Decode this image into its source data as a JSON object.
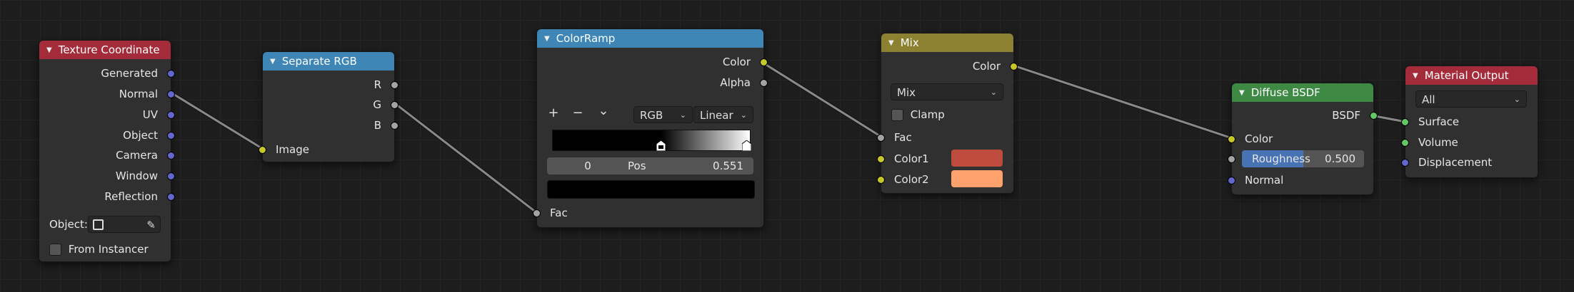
{
  "nodes": {
    "texture_coordinate": {
      "title": "Texture Coordinate",
      "outputs": [
        "Generated",
        "Normal",
        "UV",
        "Object",
        "Camera",
        "Window",
        "Reflection"
      ],
      "object_label": "Object:",
      "from_instancer": "From Instancer"
    },
    "separate_rgb": {
      "title": "Separate RGB",
      "outputs": [
        "R",
        "G",
        "B"
      ],
      "input": "Image"
    },
    "color_ramp": {
      "title": "ColorRamp",
      "outputs": [
        "Color",
        "Alpha"
      ],
      "add": "+",
      "remove": "−",
      "menu": "⌄",
      "color_mode": "RGB",
      "interpolation": "Linear",
      "stop_index": "0",
      "pos_label": "Pos",
      "pos_value": "0.551",
      "stop_color": "#000000",
      "ramp_start": 0.551,
      "input": "Fac"
    },
    "mix": {
      "title": "Mix",
      "output": "Color",
      "blend_type": "Mix",
      "clamp": "Clamp",
      "inputs": [
        "Fac",
        "Color1",
        "Color2"
      ],
      "color1": "#bf4b3d",
      "color2": "#ffa16d"
    },
    "diffuse_bsdf": {
      "title": "Diffuse BSDF",
      "output": "BSDF",
      "color_input": "Color",
      "roughness_label": "Roughness",
      "roughness_value": "0.500",
      "roughness": 0.5,
      "normal_input": "Normal"
    },
    "material_output": {
      "title": "Material Output",
      "target": "All",
      "inputs": [
        "Surface",
        "Volume",
        "Displacement"
      ]
    }
  },
  "colors": {
    "background": "#1d1d1d",
    "node_body": "#303030",
    "wire": "#8a8a8a",
    "header_input": "#a42c3a",
    "header_converter": "#3d86b6",
    "header_color": "#8b8130",
    "header_shader": "#3e8a45",
    "socket_vector": "#6466cf",
    "socket_float": "#a3a3a3",
    "socket_color": "#c7c729",
    "socket_shader": "#63c763"
  }
}
